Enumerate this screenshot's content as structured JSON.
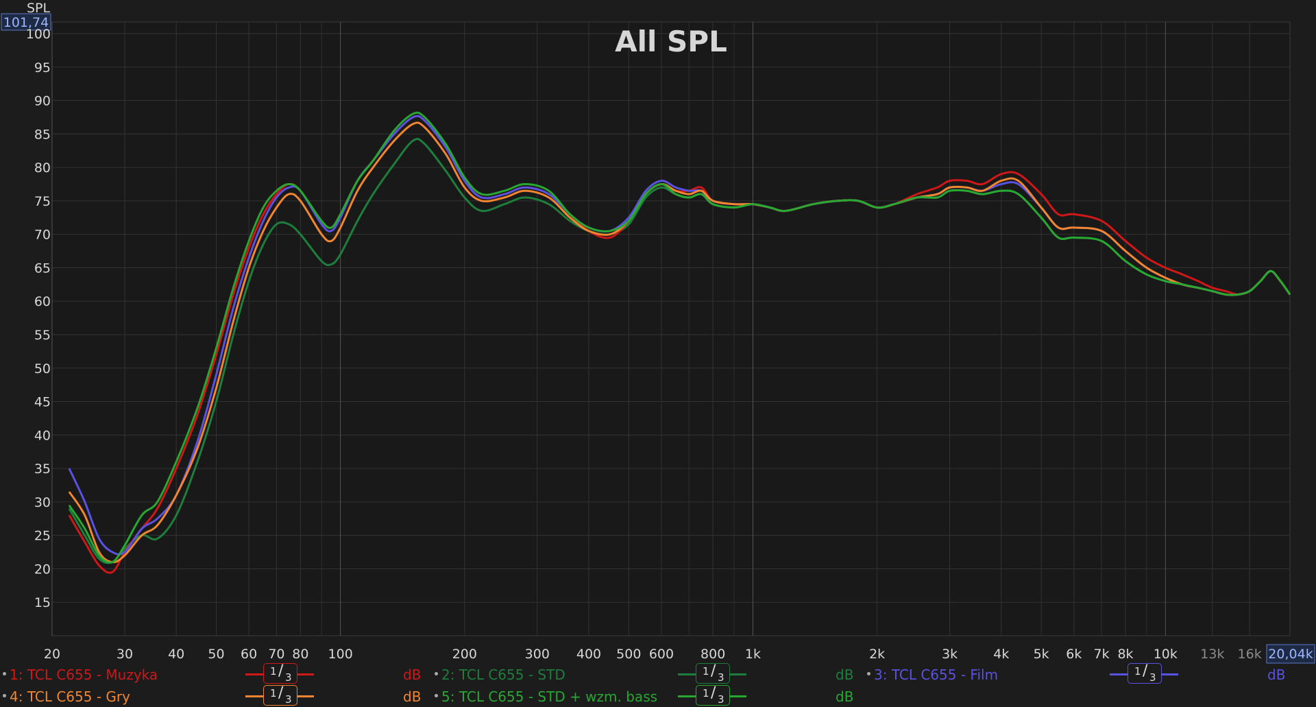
{
  "chart_data": {
    "type": "line",
    "title": "All SPL",
    "ylabel": "SPL",
    "y_readout": "101,74",
    "x_readout": "20,04k",
    "xscale": "log",
    "xlim": [
      20,
      20040
    ],
    "ylim": [
      10,
      101.74
    ],
    "yticks": [
      15,
      20,
      25,
      30,
      35,
      40,
      45,
      50,
      55,
      60,
      65,
      70,
      75,
      80,
      85,
      90,
      95,
      100
    ],
    "xticks": [
      {
        "v": 20,
        "label": "20",
        "major": true
      },
      {
        "v": 30,
        "label": "30"
      },
      {
        "v": 40,
        "label": "40"
      },
      {
        "v": 50,
        "label": "50"
      },
      {
        "v": 60,
        "label": "60"
      },
      {
        "v": 70,
        "label": "70"
      },
      {
        "v": 80,
        "label": "80"
      },
      {
        "v": 100,
        "label": "100",
        "major": true
      },
      {
        "v": 200,
        "label": "200"
      },
      {
        "v": 300,
        "label": "300"
      },
      {
        "v": 400,
        "label": "400"
      },
      {
        "v": 500,
        "label": "500"
      },
      {
        "v": 600,
        "label": "600"
      },
      {
        "v": 800,
        "label": "800"
      },
      {
        "v": 1000,
        "label": "1k",
        "major": true
      },
      {
        "v": 2000,
        "label": "2k"
      },
      {
        "v": 3000,
        "label": "3k"
      },
      {
        "v": 4000,
        "label": "4k"
      },
      {
        "v": 5000,
        "label": "5k"
      },
      {
        "v": 6000,
        "label": "6k"
      },
      {
        "v": 7000,
        "label": "7k"
      },
      {
        "v": 8000,
        "label": "8k"
      },
      {
        "v": 10000,
        "label": "10k",
        "major": true
      },
      {
        "v": 13000,
        "label": "13k",
        "dim": true
      },
      {
        "v": 16000,
        "label": "16k",
        "dim": true
      }
    ],
    "minor_x": [
      90,
      700,
      900,
      6000,
      7000,
      9000,
      20000
    ],
    "x": [
      22,
      24,
      26,
      28,
      30,
      33,
      36,
      40,
      45,
      50,
      55,
      60,
      65,
      70,
      75,
      80,
      90,
      95,
      100,
      110,
      120,
      135,
      150,
      160,
      180,
      200,
      220,
      250,
      280,
      320,
      360,
      400,
      450,
      500,
      550,
      600,
      650,
      700,
      750,
      800,
      900,
      1000,
      1100,
      1200,
      1400,
      1600,
      1800,
      2000,
      2200,
      2500,
      2800,
      3000,
      3300,
      3600,
      4000,
      4400,
      5000,
      5500,
      6000,
      7000,
      8000,
      9000,
      10000,
      11000,
      12000,
      13000,
      14000,
      15000,
      16000,
      17000,
      18000,
      19000,
      20040
    ],
    "series": [
      {
        "name": "1: TCL C655 - Muzyka",
        "color": "#d01818",
        "values": [
          28,
          24,
          20.5,
          19.5,
          22.5,
          26,
          29,
          35,
          43,
          52,
          61,
          68,
          73,
          76,
          77.5,
          76.5,
          72,
          71,
          73,
          78,
          81,
          85,
          87.5,
          87,
          83,
          78,
          75.5,
          76,
          77,
          76,
          73,
          70.5,
          69.5,
          72,
          76,
          77.5,
          76.5,
          76.5,
          77,
          75,
          74.5,
          74.5,
          74,
          73.5,
          74.5,
          75,
          75,
          74,
          74.5,
          76,
          77,
          78,
          78,
          77.5,
          79,
          79,
          76,
          73,
          73,
          72,
          69,
          66.5,
          65,
          64,
          63,
          62,
          61.5,
          61,
          61.5,
          63,
          64.5,
          63,
          61,
          60
        ]
      },
      {
        "name": "2: TCL C655 - STD",
        "color": "#1e7e3c",
        "values": [
          29,
          25,
          21.5,
          21,
          23,
          25,
          24.5,
          28,
          36,
          45,
          55,
          63,
          68.5,
          71.5,
          71.5,
          70,
          66,
          65.5,
          67,
          72,
          76,
          80.5,
          84,
          83.5,
          79.5,
          75.5,
          73.5,
          74.5,
          75.5,
          74.5,
          72,
          70.5,
          70,
          71.5,
          75.5,
          77,
          76,
          75.5,
          76,
          74.5,
          74,
          74.5,
          74,
          73.5,
          74.5,
          75,
          75,
          74,
          74.5,
          75.5,
          75.5,
          76.5,
          76.5,
          76,
          76.5,
          76,
          72.5,
          69.5,
          69.5,
          69,
          66,
          64,
          63,
          62.5,
          62,
          61.5,
          61,
          61,
          61.5,
          63,
          64.5,
          63,
          61,
          60
        ]
      },
      {
        "name": "3: TCL C655 - Film",
        "color": "#5a52e0",
        "values": [
          35,
          30,
          24.5,
          22.5,
          22.5,
          26,
          27.5,
          31,
          39,
          49,
          59,
          66.5,
          72,
          75.5,
          77,
          76.5,
          71.5,
          70.5,
          72.5,
          78,
          81,
          85,
          87.5,
          87,
          83,
          78,
          75.5,
          76,
          77,
          76,
          73,
          71,
          70.5,
          72.5,
          76.5,
          78,
          77,
          76.5,
          76.5,
          75,
          74.5,
          74.5,
          74,
          73.5,
          74.5,
          75,
          75,
          74,
          74.5,
          75.5,
          76,
          77,
          77,
          76.5,
          77.5,
          77.5,
          74,
          71,
          71,
          70.5,
          67.5,
          65,
          63.5,
          62.5,
          62,
          61.5,
          61,
          61,
          61.5,
          63,
          64.5,
          63,
          61,
          60
        ]
      },
      {
        "name": "4: TCL C655 - Gry",
        "color": "#f28630",
        "values": [
          31.5,
          28,
          22.5,
          21,
          22,
          25,
          26.5,
          31,
          38,
          47,
          57,
          65,
          70.5,
          74,
          76,
          75,
          70,
          69,
          71,
          76.5,
          80,
          84,
          86.5,
          86,
          82,
          77,
          75,
          75.5,
          76.5,
          75.5,
          72.5,
          70.5,
          70,
          72,
          76,
          77.5,
          76.5,
          76,
          76.5,
          75,
          74.5,
          74.5,
          74,
          73.5,
          74.5,
          75,
          75,
          74,
          74.5,
          75.5,
          76,
          77,
          77,
          76.5,
          78,
          78,
          74,
          71,
          71,
          70.5,
          67.5,
          65,
          63.5,
          62.5,
          62,
          61.5,
          61,
          61,
          61.5,
          63,
          64.5,
          63,
          61,
          60
        ]
      },
      {
        "name": "5: TCL C655 - STD + wzm. bass",
        "color": "#28a832",
        "values": [
          29.5,
          26,
          22,
          21,
          23.5,
          28,
          30,
          36,
          44,
          53,
          62,
          69,
          74,
          76.5,
          77.5,
          76.5,
          72,
          71,
          73,
          78,
          81,
          85.5,
          88,
          87.5,
          83.5,
          78.5,
          76,
          76.5,
          77.5,
          76.5,
          73,
          71,
          70.5,
          72,
          76,
          77.5,
          76,
          75.5,
          76,
          74.5,
          74,
          74.5,
          74,
          73.5,
          74.5,
          75,
          75,
          74,
          74.5,
          75.5,
          75.5,
          76.5,
          76.5,
          76,
          76.5,
          76,
          72.5,
          69.5,
          69.5,
          69,
          66,
          64,
          63,
          62.5,
          62,
          61.5,
          61,
          61,
          61.5,
          63,
          64.5,
          63,
          61,
          60
        ]
      }
    ]
  },
  "legend": {
    "items": [
      {
        "label": "1: TCL C655 - Muzyka",
        "color": "#d01818",
        "smoothing_num": "1",
        "smoothing_den": "3",
        "unit": "dB"
      },
      {
        "label": "2: TCL C655 - STD",
        "color": "#1e7e3c",
        "smoothing_num": "1",
        "smoothing_den": "3",
        "unit": "dB"
      },
      {
        "label": "3: TCL C655 - Film",
        "color": "#5a52e0",
        "smoothing_num": "1",
        "smoothing_den": "3",
        "unit": "dB"
      },
      {
        "label": "4: TCL C655 - Gry",
        "color": "#f28630",
        "smoothing_num": "1",
        "smoothing_den": "3",
        "unit": "dB"
      },
      {
        "label": "5: TCL C655 - STD + wzm. bass",
        "color": "#28a832",
        "smoothing_num": "1",
        "smoothing_den": "3",
        "unit": "dB"
      }
    ]
  }
}
